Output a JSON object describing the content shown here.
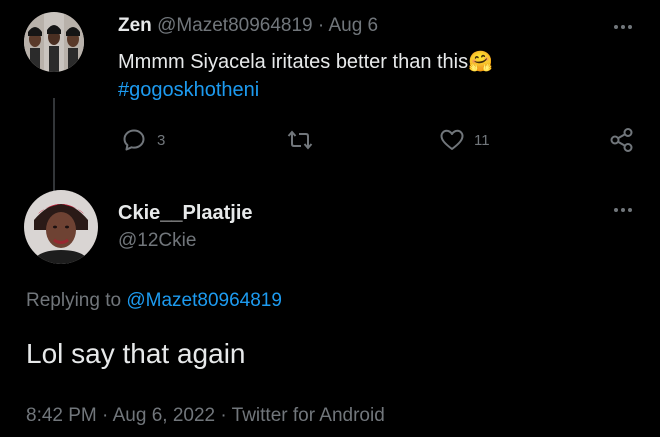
{
  "parent_tweet": {
    "display_name": "Zen",
    "handle": "@Mazet80964819",
    "separator": "·",
    "date": "Aug 6",
    "text": "Mmmm Siyacela iritates better than this",
    "emoji": "🤗",
    "hashtag": "#gogoskhotheni",
    "reply_count": "3",
    "retweet_count": "",
    "like_count": "11"
  },
  "reply_tweet": {
    "display_name": "Ckie__Plaatjie",
    "handle": "@12Ckie",
    "replying_prefix": "Replying to",
    "replying_to": "@Mazet80964819",
    "text": "Lol say that again",
    "time": "8:42 PM",
    "dot": "·",
    "date": "Aug 6, 2022",
    "dot2": "·",
    "source": "Twitter for Android"
  },
  "icons": {
    "more": "more-horizontal-icon",
    "reply": "reply-bubble-icon",
    "retweet": "retweet-icon",
    "like": "heart-icon",
    "share": "share-icon"
  },
  "colors": {
    "background": "#000000",
    "text": "#e7e9ea",
    "muted": "#71767b",
    "accent": "#1d9bf0"
  }
}
